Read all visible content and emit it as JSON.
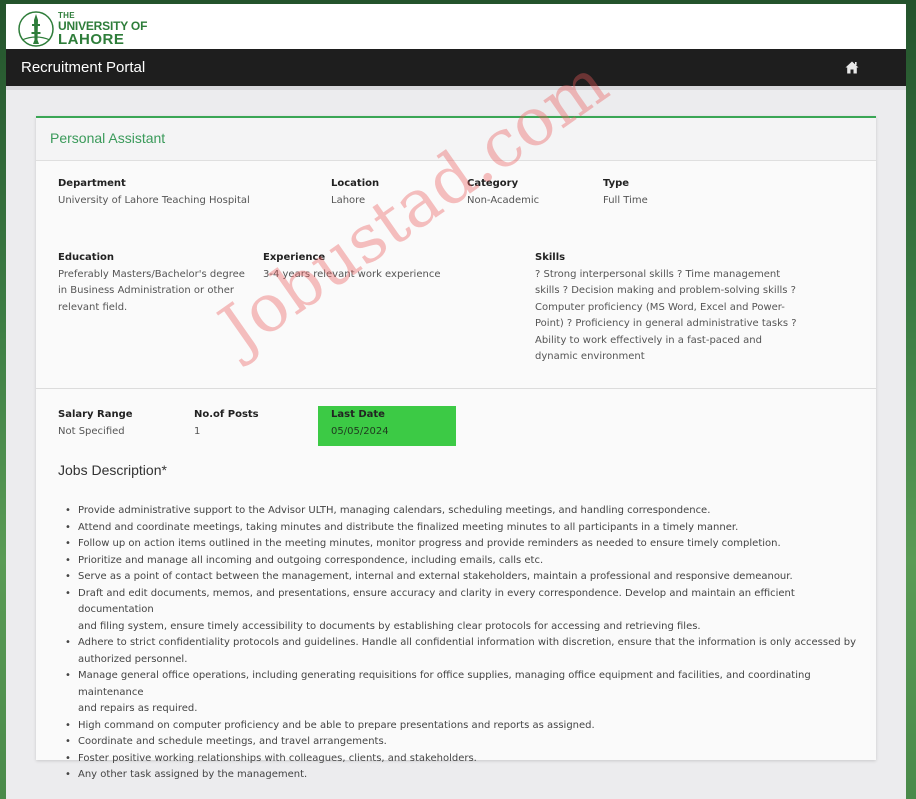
{
  "header": {
    "logo_line1": "THE",
    "logo_line2": "UNIVERSITY OF",
    "logo_line3": "LAHORE",
    "portal_title": "Recruitment Portal",
    "home_icon": "home-icon"
  },
  "job": {
    "title": "Personal Assistant",
    "department_label": "Department",
    "department": "University of Lahore Teaching Hospital",
    "location_label": "Location",
    "location": "Lahore",
    "category_label": "Category",
    "category": "Non-Academic",
    "type_label": "Type",
    "type": "Full Time",
    "education_label": "Education",
    "education_lines": [
      "Preferably Masters/Bachelor's degree",
      "in Business Administration or other",
      "relevant field."
    ],
    "experience_label": "Experience",
    "experience": "3-4 years relevant work experience",
    "skills_label": "Skills",
    "skills_lines": [
      "? Strong interpersonal skills ? Time management",
      "skills ? Decision making and problem-solving skills ?",
      "Computer proficiency (MS Word, Excel and Power-",
      "Point) ? Proficiency in general administrative tasks ?",
      "Ability to work effectively in a fast-paced and",
      "dynamic environment"
    ],
    "salary_label": "Salary Range",
    "salary": "Not Specified",
    "posts_label": "No.of Posts",
    "posts": "1",
    "last_date_label": "Last Date",
    "last_date": "05/05/2024",
    "last_date_highlight": "#3cca45",
    "description_title": "Jobs Description*",
    "description_items": [
      [
        "Provide administrative support to the Advisor ULTH, managing calendars, scheduling meetings, and handling correspondence."
      ],
      [
        " Attend and coordinate meetings, taking minutes and distribute the finalized meeting minutes to all participants in a timely manner."
      ],
      [
        " Follow up on action items outlined in the meeting minutes, monitor progress and provide reminders as needed to ensure timely completion."
      ],
      [
        " Prioritize and manage all incoming and outgoing correspondence, including emails, calls etc."
      ],
      [
        " Serve as a point of contact between the management, internal and external stakeholders, maintain a professional and responsive demeanour."
      ],
      [
        " Draft and edit documents, memos, and presentations, ensure accuracy and clarity in every correspondence.  Develop and maintain an efficient documentation",
        "and filing system, ensure timely accessibility to documents by establishing clear protocols for accessing and retrieving files."
      ],
      [
        " Adhere to strict confidentiality protocols and guidelines. Handle all confidential information with discretion, ensure that the information is only accessed by",
        "authorized personnel."
      ],
      [
        "Manage general office operations, including generating requisitions for office supplies, managing office equipment and facilities, and coordinating maintenance",
        "and repairs as required."
      ],
      [
        " High command on computer proficiency and be able to prepare presentations and reports as assigned."
      ],
      [
        "Coordinate and schedule meetings, and travel arrangements."
      ],
      [
        " Foster positive working relationships with colleagues, clients, and stakeholders."
      ],
      [
        "Any other task assigned by the management."
      ]
    ]
  },
  "watermark": "Jobustad.com",
  "colors": {
    "accent_green": "#3aa655",
    "navbar": "#1e1e1e"
  }
}
